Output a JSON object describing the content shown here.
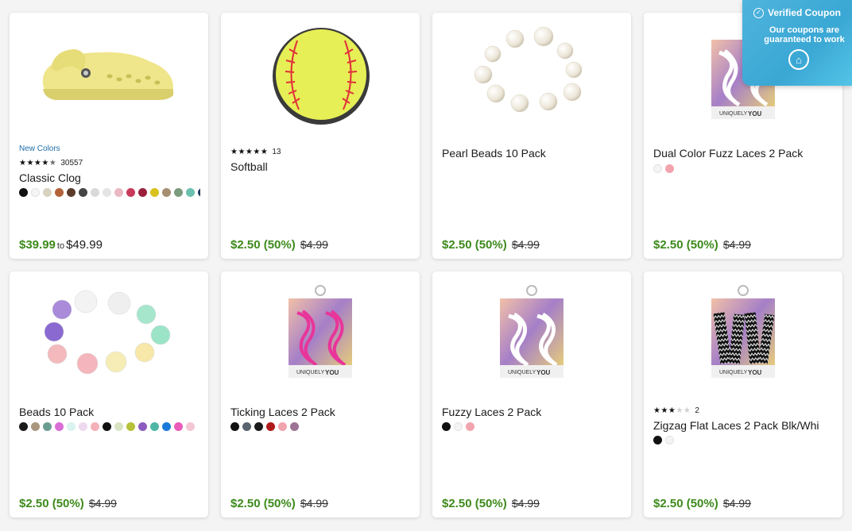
{
  "products": [
    {
      "name": "Classic Clog",
      "badge": "New Colors",
      "rating": 4.5,
      "rating_count": "30557",
      "image_icon": "yellow-clog-image",
      "swatches": [
        "#111111",
        "#f5f5f5",
        "#d8d2c0",
        "#b5623a",
        "#5b3b2a",
        "#444444",
        "#d9d9d9",
        "#e4e4e4",
        "#e9b8c3",
        "#c73a5a",
        "#9a1f3c",
        "#d8c21c",
        "#a58e72",
        "#7a9b7d",
        "#6cc0ae",
        "#1e3a5f",
        "#3a8fd0"
      ],
      "price_sale": "$39.99",
      "price_to": "to",
      "price_max": "$49.99"
    },
    {
      "name": "Softball",
      "rating": 5,
      "rating_count": "13",
      "image_icon": "softball-charm-image",
      "swatches": [],
      "price_sale": "$2.50 (50%)",
      "price_orig": "$4.99"
    },
    {
      "name": "Pearl Beads 10 Pack",
      "image_icon": "pearl-beads-image",
      "swatches": [],
      "price_sale": "$2.50 (50%)",
      "price_orig": "$4.99"
    },
    {
      "name": "Dual Color Fuzz Laces 2 Pack",
      "image_icon": "white-laces-package-image",
      "swatches": [
        "#f4f4f4",
        "#f2a4ae"
      ],
      "price_sale": "$2.50 (50%)",
      "price_orig": "$4.99"
    },
    {
      "name": "Beads 10 Pack",
      "image_icon": "pastel-beads-image",
      "swatches": [
        "#1a1a1a",
        "#a9967e",
        "#6b9c92",
        "#d96ed7",
        "#d9f3ef",
        "#eed9ee",
        "#f4b0b8",
        "#111111",
        "#d8e3c2",
        "#b6c23a",
        "#8b5cbd",
        "#4fb6a6",
        "#1a7ad8",
        "#ea5bb9",
        "#f3c7d3"
      ],
      "price_sale": "$2.50 (50%)",
      "price_orig": "$4.99"
    },
    {
      "name": "Ticking Laces 2 Pack",
      "image_icon": "pink-laces-package-image",
      "swatches": [
        "#111111",
        "#5a6470",
        "#1a1a1a",
        "#b01a1a",
        "#f2a4ae",
        "#9c7394"
      ],
      "price_sale": "$2.50 (50%)",
      "price_orig": "$4.99"
    },
    {
      "name": "Fuzzy Laces 2 Pack",
      "image_icon": "white-fuzzy-laces-package-image",
      "swatches": [
        "#111111",
        "#f4f4f4",
        "#f2a4ae"
      ],
      "price_sale": "$2.50 (50%)",
      "price_orig": "$4.99"
    },
    {
      "name": "Zigzag Flat Laces 2 Pack Blk/Whi",
      "rating": 3,
      "rating_count": "2",
      "image_icon": "zigzag-laces-package-image",
      "swatches": [
        "#111111",
        "#f4f4f4"
      ],
      "price_sale": "$2.50 (50%)",
      "price_orig": "$4.99"
    }
  ],
  "coupon": {
    "title": "Verified Coupon",
    "line1": "Our coupons are",
    "line2": "guaranteed to work",
    "check_icon": "check-circle-icon",
    "logo_icon": "house-logo-icon"
  }
}
